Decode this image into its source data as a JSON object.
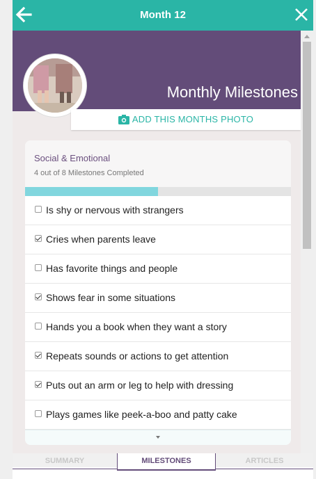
{
  "header": {
    "title": "Month 12",
    "back_icon": "arrow-left-icon",
    "close_icon": "close-icon",
    "bg_color": "#2ab5a6"
  },
  "hero": {
    "title": "Monthly Milestones",
    "bg_color": "#634c79",
    "photo_button_label": "ADD THIS MONTHS PHOTO",
    "photo_icon": "camera-icon"
  },
  "category": {
    "name": "Social & Emotional",
    "summary": "4 out of 8 Milestones Completed",
    "completed": 4,
    "total": 8,
    "progress_color": "#81d6de"
  },
  "milestones": [
    {
      "label": "Is shy or nervous with strangers",
      "checked": false
    },
    {
      "label": "Cries when parents leave",
      "checked": true
    },
    {
      "label": "Has favorite things and people",
      "checked": false
    },
    {
      "label": "Shows fear in some situations",
      "checked": true
    },
    {
      "label": "Hands you a book when they want a story",
      "checked": false
    },
    {
      "label": "Repeats sounds or actions to get attention",
      "checked": true
    },
    {
      "label": "Puts out an arm or leg to help with dressing",
      "checked": true
    },
    {
      "label": "Plays games like peek-a-boo and patty cake",
      "checked": false
    }
  ],
  "tabs": [
    {
      "label": "SUMMARY",
      "active": false
    },
    {
      "label": "MILESTONES",
      "active": true
    },
    {
      "label": "ARTICLES",
      "active": false
    }
  ]
}
